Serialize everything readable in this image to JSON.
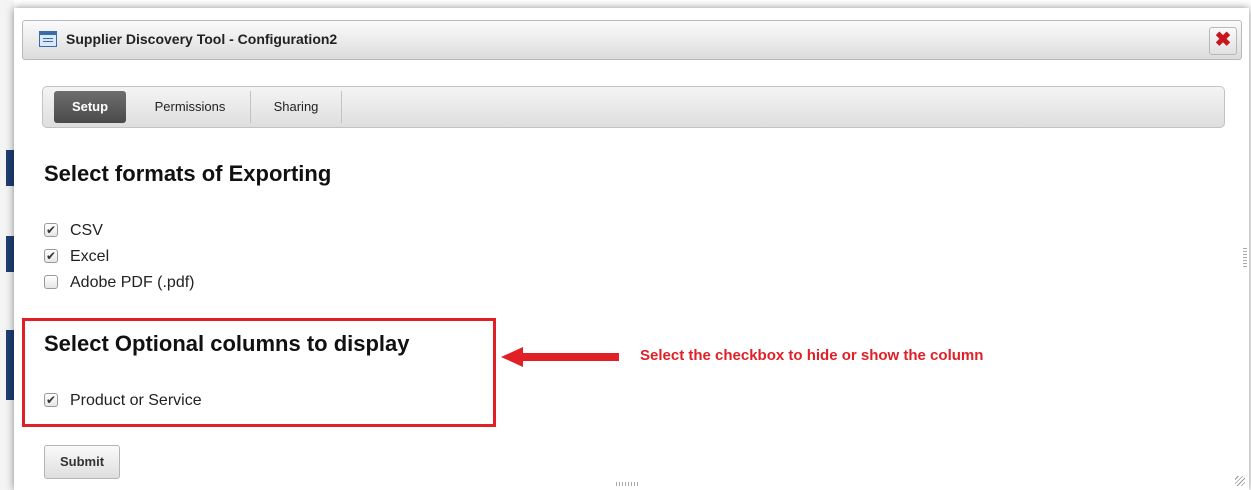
{
  "dialog": {
    "title": "Supplier Discovery Tool - Configuration2",
    "close_icon": "close-icon",
    "window_icon": "window-icon"
  },
  "tabs": [
    {
      "label": "Setup",
      "active": true
    },
    {
      "label": "Permissions",
      "active": false
    },
    {
      "label": "Sharing",
      "active": false
    }
  ],
  "export_section": {
    "title": "Select formats of Exporting",
    "options": [
      {
        "label": "CSV",
        "checked": true
      },
      {
        "label": "Excel",
        "checked": true
      },
      {
        "label": "Adobe PDF (.pdf)",
        "checked": false
      }
    ]
  },
  "columns_section": {
    "title": "Select Optional columns to display",
    "options": [
      {
        "label": "Product or Service",
        "checked": true
      }
    ]
  },
  "annotation": {
    "text": "Select the checkbox to hide or show the column",
    "color": "#e01f26"
  },
  "actions": {
    "submit_label": "Submit"
  },
  "colors": {
    "accent": "#e01f26",
    "active_tab": "#555555",
    "close_icon": "#c8161d"
  }
}
